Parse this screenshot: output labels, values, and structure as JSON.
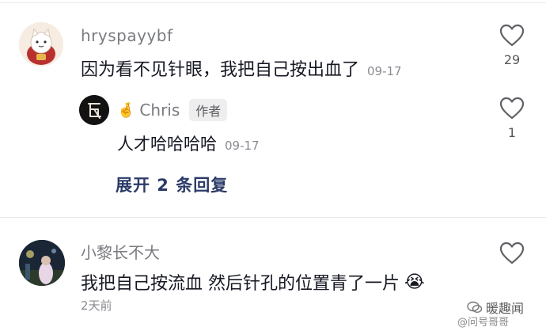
{
  "comments": [
    {
      "username": "hryspayybf",
      "text": "因为看不见针眼，我把自己按出血了",
      "date": "09-17",
      "likes": "29",
      "avatar": "lucky-cat-avatar"
    },
    {
      "username": "Chris",
      "name_emoji": "🤞",
      "tag": "作者",
      "text": "人才哈哈哈哈",
      "date": "09-17",
      "likes": "1",
      "avatar": "calligraphy-avatar"
    }
  ],
  "expand_replies": "展开 2 条回复",
  "comment3": {
    "username": "小黎长不大",
    "text": "我把自己按流血 然后针孔的位置青了一片",
    "emoji": "😭",
    "time": "2天前",
    "avatar": "night-photo-avatar"
  },
  "watermark": {
    "brand": "暖趣闻",
    "handle": "@问号哥哥"
  },
  "colors": {
    "expand_link": "#2b3a67",
    "username": "#7a7b80",
    "comment_text": "#161823",
    "meta_text": "#8a8b91"
  }
}
